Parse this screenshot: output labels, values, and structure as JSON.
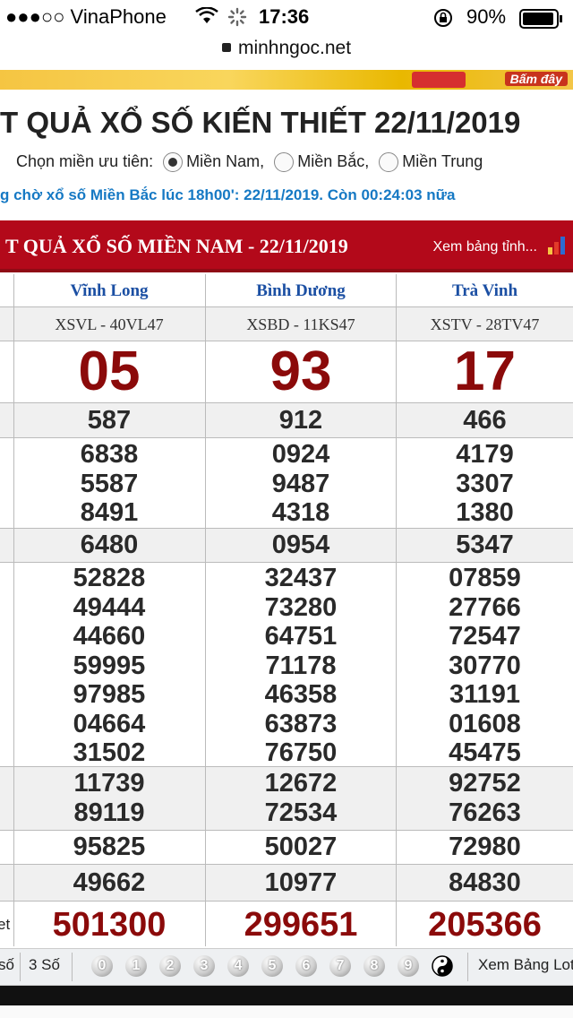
{
  "status": {
    "carrier": "●●●○○ VinaPhone",
    "time": "17:36",
    "battery": "90%",
    "url": "minhngoc.net"
  },
  "banner": {
    "cta": "Bấm đây"
  },
  "page": {
    "title": "T QUẢ XỔ SỐ KIẾN THIẾT 22/11/2019",
    "pref_label": "Chọn miền ưu tiên:",
    "pref_options": [
      "Miền Nam,",
      "Miền Bắc,",
      "Miền Trung"
    ],
    "pref_selected": "Miền Nam,",
    "countdown": "g chờ xổ số Miền Bắc lúc 18h00': 22/11/2019. Còn 00:24:03 nữa"
  },
  "results_header": {
    "title": "T QUẢ XỔ SỐ MIỀN NAM - 22/11/2019",
    "view_table": "Xem bảng tỉnh..."
  },
  "table": {
    "provinces": [
      "Vĩnh Long",
      "Bình Dương",
      "Trà Vinh"
    ],
    "codes": [
      "XSVL - 40VL47",
      "XSBD - 11KS47",
      "XSTV - 28TV47"
    ],
    "g8": [
      "05",
      "93",
      "17"
    ],
    "g7": [
      "587",
      "912",
      "466"
    ],
    "g6": [
      [
        "6838",
        "5587",
        "8491"
      ],
      [
        "0924",
        "9487",
        "4318"
      ],
      [
        "4179",
        "3307",
        "1380"
      ]
    ],
    "g5": [
      "6480",
      "0954",
      "5347"
    ],
    "g4": [
      [
        "52828",
        "49444",
        "44660",
        "59995",
        "97985",
        "04664",
        "31502"
      ],
      [
        "32437",
        "73280",
        "64751",
        "71178",
        "46358",
        "63873",
        "76750"
      ],
      [
        "07859",
        "27766",
        "72547",
        "30770",
        "31191",
        "01608",
        "45475"
      ]
    ],
    "g3": [
      [
        "11739",
        "89119"
      ],
      [
        "12672",
        "72534"
      ],
      [
        "92752",
        "76263"
      ]
    ],
    "g2": [
      "95825",
      "50027",
      "72980"
    ],
    "g1": [
      "49662",
      "10977",
      "84830"
    ],
    "special_label_stub": "et",
    "special": [
      "501300",
      "299651",
      "205366"
    ]
  },
  "bottombar": {
    "label_left": "số",
    "label_3so": "3 Số",
    "balls": [
      "0",
      "1",
      "2",
      "3",
      "4",
      "5",
      "6",
      "7",
      "8",
      "9"
    ],
    "view_loto": "Xem Bảng Loto"
  }
}
